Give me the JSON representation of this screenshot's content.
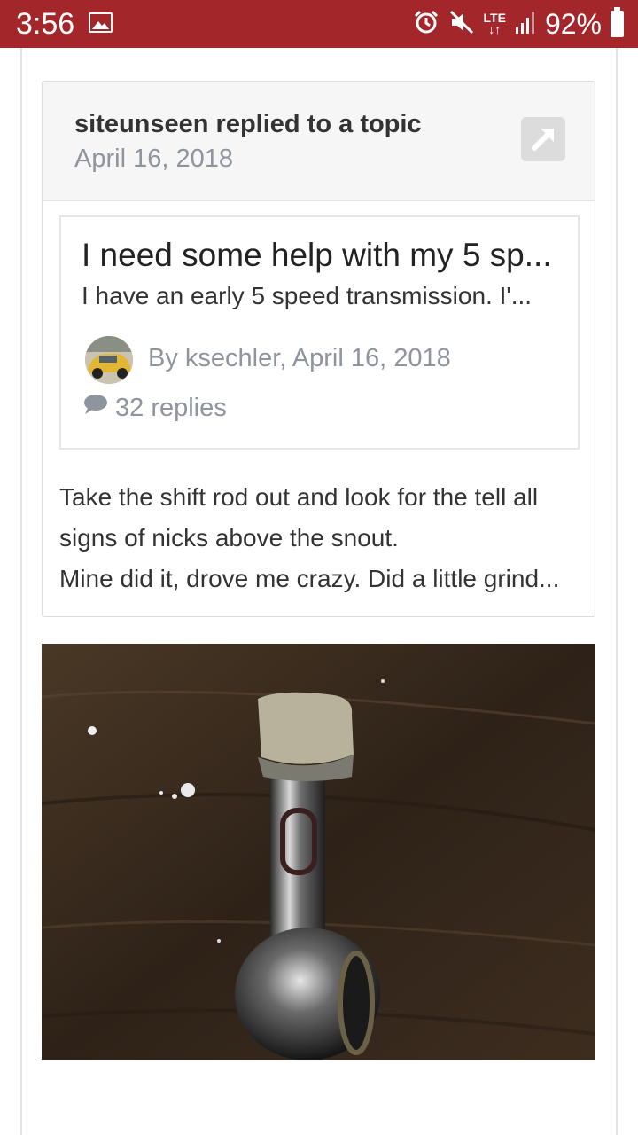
{
  "status_bar": {
    "time": "3:56",
    "battery": "92%",
    "network": "LTE",
    "color": "#a3262b"
  },
  "activity": {
    "action": "siteunseen replied to a topic",
    "date": "April 16, 2018"
  },
  "topic": {
    "title": "I need some help with my 5 sp...",
    "snippet": "I have an early 5 speed transmission.  I'...",
    "byline": "By ksechler, April 16, 2018",
    "replies": "32 replies"
  },
  "post": {
    "lines": [
      "Take the shift rod out and look for the tell all",
      "signs of nicks above the snout.",
      "Mine did it, drove me crazy.  Did a little grind..."
    ]
  },
  "icons": {
    "status_image": "image-icon",
    "alarm": "alarm-icon",
    "mute": "mute-icon",
    "signal": "signal-icon",
    "battery": "battery-icon",
    "share": "external-link-icon",
    "comment": "comment-icon"
  }
}
